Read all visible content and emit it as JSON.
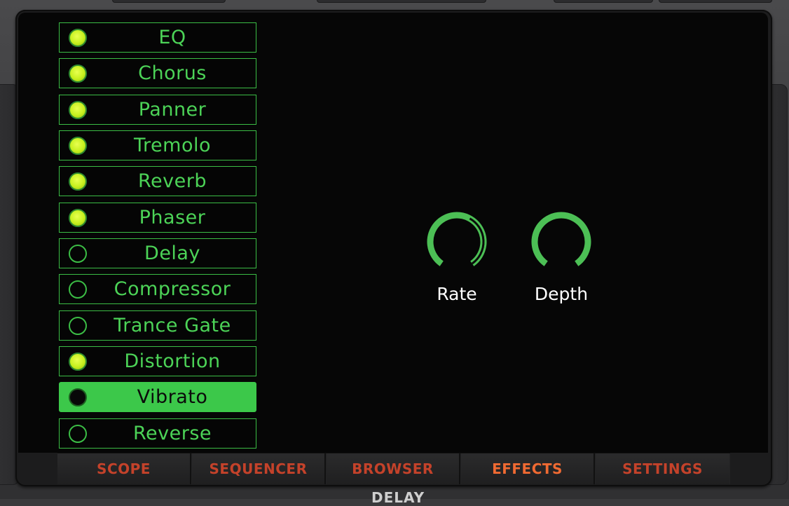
{
  "effects": [
    {
      "label": "EQ",
      "led": "on"
    },
    {
      "label": "Chorus",
      "led": "on"
    },
    {
      "label": "Panner",
      "led": "on"
    },
    {
      "label": "Tremolo",
      "led": "on"
    },
    {
      "label": "Reverb",
      "led": "on"
    },
    {
      "label": "Phaser",
      "led": "on"
    },
    {
      "label": "Delay",
      "led": "off"
    },
    {
      "label": "Compressor",
      "led": "off"
    },
    {
      "label": "Trance Gate",
      "led": "off"
    },
    {
      "label": "Distortion",
      "led": "on"
    },
    {
      "label": "Vibrato",
      "led": "dark",
      "selected": true
    },
    {
      "label": "Reverse",
      "led": "off"
    }
  ],
  "knobs": {
    "rate": {
      "label": "Rate",
      "value": 0.4
    },
    "depth": {
      "label": "Depth",
      "value": 0.0
    }
  },
  "tabs": [
    {
      "label": "SCOPE"
    },
    {
      "label": "SEQUENCER"
    },
    {
      "label": "BROWSER"
    },
    {
      "label": "EFFECTS",
      "active": true
    },
    {
      "label": "SETTINGS"
    }
  ],
  "footer": {
    "partial_label": "DELAY"
  },
  "colors": {
    "accent_green": "#3cc84a",
    "led_on": "#c6f01e",
    "tab_text": "#c4422a",
    "tab_active": "#f06a32"
  }
}
